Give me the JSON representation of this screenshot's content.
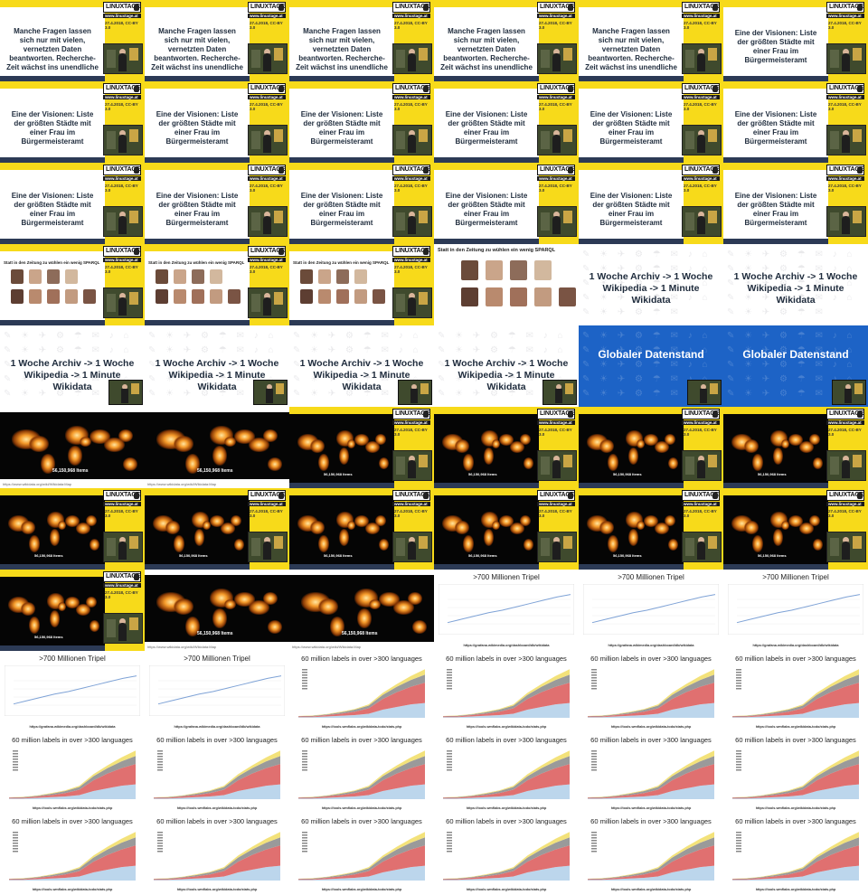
{
  "colors": {
    "yellow": "#f7da1a",
    "blue": "#1d63c6",
    "navy_text": "#1e2b3c"
  },
  "brand": {
    "name": "LINUXTAGE",
    "url": "www.linuxtage.at",
    "license": "27.4.2018, CC-BY 3.0"
  },
  "slides": {
    "manche": "Manche Fragen lassen sich nur mit vielen, vernetzten Daten beantworten. Recherche-Zeit wächst ins unendliche",
    "visionen": "Eine der Visionen: Liste der größten Städte mit einer Frau im Bürgermeisteramt",
    "zeitung": "Statt in den Zeitung zu wühlen ein wenig SPARQL",
    "archiv": "1 Woche Archiv -> 1 Woche Wikipedia -> 1 Minute Wikidata",
    "global": "Globaler Datenstand",
    "items": "56,150,968 Items",
    "tripel": ">700 Millionen Tripel",
    "tripel_url": "https://grafana.wikimedia.org/dashboard/db/wikidata",
    "labels": "60 million labels in over >300 languages",
    "labels_url": "https://tools.wmflabs.org/wikidata-todo/stats.php",
    "map_url": "https://www.wikidata.org/wiki/Wikidata:Map"
  },
  "icon_names": [
    "penguin-icon",
    "webcam-feed"
  ],
  "chart_data": [
    {
      "type": "line",
      "title": ">700 Millionen Tripel",
      "series": [
        {
          "values": [
            380,
            420,
            460,
            500,
            530,
            570,
            610,
            650,
            690,
            720
          ]
        }
      ]
    },
    {
      "type": "area",
      "title": "60 million labels in over >300 languages",
      "series": [
        {
          "values": [
            1,
            1,
            2,
            3,
            4,
            6,
            12,
            16,
            20,
            22
          ]
        },
        {
          "values": [
            1,
            1,
            2,
            3,
            5,
            8,
            16,
            22,
            26,
            30
          ]
        },
        {
          "values": [
            0.5,
            1,
            1,
            2,
            3,
            4,
            6,
            8,
            10,
            12
          ]
        },
        {
          "values": [
            0.2,
            0.5,
            0.5,
            1,
            1,
            2,
            3,
            4,
            6,
            8
          ]
        }
      ]
    }
  ]
}
